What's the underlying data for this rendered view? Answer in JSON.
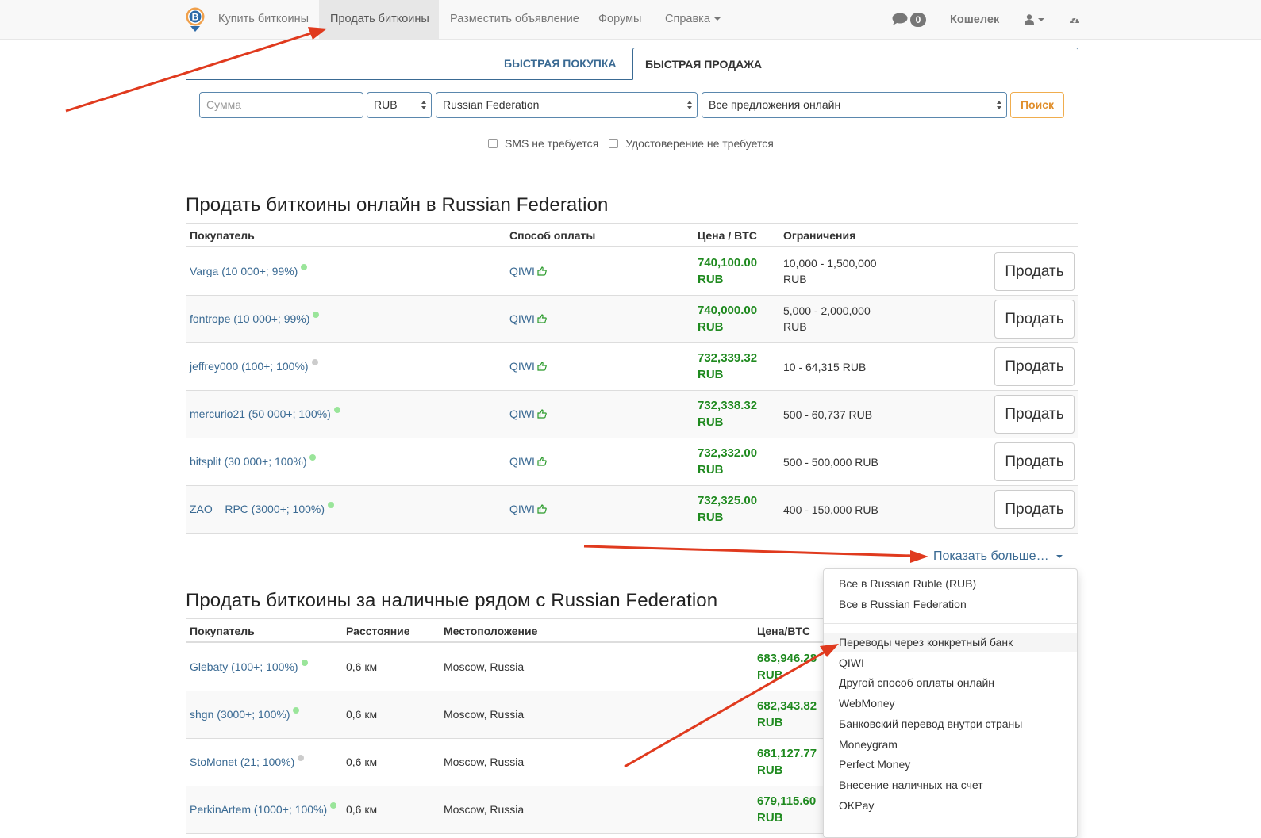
{
  "navbar": {
    "logo": "localbitcoins-logo-icon",
    "items": [
      {
        "label": "Купить биткоины",
        "active": false
      },
      {
        "label": "Продать биткоины",
        "active": true
      },
      {
        "label": "Разместить объявление",
        "active": false
      },
      {
        "label": "Форумы",
        "active": false
      },
      {
        "label": "Справка",
        "active": false,
        "dropdown": true
      }
    ],
    "messages_icon": "chat-bubble-icon",
    "messages_count": "0",
    "wallet_label": "Кошелек",
    "user_icon": "user-icon",
    "dashboard_icon": "dashboard-icon"
  },
  "quick_search": {
    "tabs": [
      {
        "label": "Быстрая покупка",
        "active": false
      },
      {
        "label": "Быстрая продажа",
        "active": true
      }
    ],
    "amount_placeholder": "Сумма",
    "amount_value": "",
    "currency": "RUB",
    "country": "Russian Federation",
    "offer_type": "Все предложения онлайн",
    "search_button": "Поиск",
    "checkboxes": [
      {
        "label": "SMS не требуется",
        "checked": false
      },
      {
        "label": "Удостоверение не требуется",
        "checked": false
      }
    ]
  },
  "online_section": {
    "title": "Продать биткоины онлайн в Russian Federation",
    "columns": [
      "Покупатель",
      "Способ оплаты",
      "Цена / BTC",
      "Ограничения"
    ],
    "rows": [
      {
        "buyer": "Varga (10 000+; 99%)",
        "status": "online",
        "payment": "QIWI",
        "price": "740,100.00",
        "currency": "RUB",
        "limits": "10,000 - 1,500,000",
        "limits_currency": "RUB",
        "button": "Продать"
      },
      {
        "buyer": "fontrope (10 000+; 99%)",
        "status": "online",
        "payment": "QIWI",
        "price": "740,000.00",
        "currency": "RUB",
        "limits": "5,000 - 2,000,000",
        "limits_currency": "RUB",
        "button": "Продать"
      },
      {
        "buyer": "jeffrey000 (100+; 100%)",
        "status": "offline",
        "payment": "QIWI",
        "price": "732,339.32",
        "currency": "RUB",
        "limits": "10 - 64,315 RUB",
        "limits_currency": "",
        "button": "Продать"
      },
      {
        "buyer": "mercurio21 (50 000+; 100%)",
        "status": "online",
        "payment": "QIWI",
        "price": "732,338.32",
        "currency": "RUB",
        "limits": "500 - 60,737 RUB",
        "limits_currency": "",
        "button": "Продать"
      },
      {
        "buyer": "bitsplit (30 000+; 100%)",
        "status": "online",
        "payment": "QIWI",
        "price": "732,332.00",
        "currency": "RUB",
        "limits": "500 - 500,000 RUB",
        "limits_currency": "",
        "button": "Продать"
      },
      {
        "buyer": "ZAO__RPC (3000+; 100%)",
        "status": "online",
        "payment": "QIWI",
        "price": "732,325.00",
        "currency": "RUB",
        "limits": "400 - 150,000 RUB",
        "limits_currency": "",
        "button": "Продать"
      }
    ],
    "show_more": "Показать больше…"
  },
  "show_more_menu": {
    "group1": [
      "Все в Russian Ruble (RUB)",
      "Все в Russian Federation"
    ],
    "group2": [
      "Переводы через конкретный банк",
      "QIWI",
      "Другой способ оплаты онлайн",
      "WebMoney",
      "Банковский перевод внутри страны",
      "Moneygram",
      "Perfect Money",
      "Внесение наличных на счет",
      "OKPay"
    ],
    "hovered": "Переводы через конкретный банк"
  },
  "cash_section": {
    "title": "Продать биткоины за наличные рядом с Russian Federation",
    "columns": [
      "Покупатель",
      "Расстояние",
      "Местоположение",
      "Цена/BTC"
    ],
    "rows": [
      {
        "buyer": "Glebaty (100+; 100%)",
        "status": "online",
        "distance": "0,6 км",
        "location": "Moscow, Russia",
        "price": "683,946.28",
        "currency": "RUB"
      },
      {
        "buyer": "shgn (3000+; 100%)",
        "status": "online",
        "distance": "0,6 км",
        "location": "Moscow, Russia",
        "price": "682,343.82",
        "currency": "RUB"
      },
      {
        "buyer": "StoMonet (21; 100%)",
        "status": "offline",
        "distance": "0,6 км",
        "location": "Moscow, Russia",
        "price": "681,127.77",
        "currency": "RUB"
      },
      {
        "buyer": "PerkinArtem (1000+; 100%)",
        "status": "online",
        "distance": "0,6 км",
        "location": "Moscow, Russia",
        "price": "679,115.60",
        "currency": "RUB"
      }
    ]
  },
  "colors": {
    "link": "#3a6a93",
    "price": "#1f8a1f",
    "search_accent": "#f0ad4e",
    "annotation_arrow": "#e03a1e",
    "status_online": "#9ae59a",
    "status_offline": "#cccccc"
  }
}
